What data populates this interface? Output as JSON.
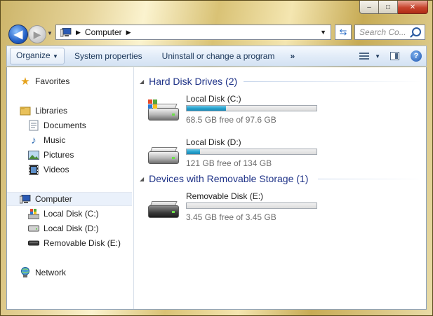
{
  "window": {
    "caption": {
      "minimize": "–",
      "maximize": "□",
      "close": "✕"
    }
  },
  "navbar": {
    "address": {
      "root_icon": "computer-icon",
      "crumb": "Computer"
    },
    "search_placeholder": "Search Co..."
  },
  "toolbar": {
    "organize": "Organize",
    "system_properties": "System properties",
    "uninstall": "Uninstall or change a program",
    "more": "»"
  },
  "sidebar": {
    "favorites": "Favorites",
    "libraries": "Libraries",
    "documents": "Documents",
    "music": "Music",
    "pictures": "Pictures",
    "videos": "Videos",
    "computer": "Computer",
    "local_c": "Local Disk (C:)",
    "local_d": "Local Disk (D:)",
    "removable_e": "Removable Disk (E:)",
    "network": "Network"
  },
  "main": {
    "groups": [
      {
        "title": "Hard Disk Drives (2)",
        "drives": [
          {
            "name": "Local Disk (C:)",
            "free_text": "68.5 GB free of 97.6 GB",
            "used_fraction": 0.3,
            "icon": "windows-drive-icon"
          },
          {
            "name": "Local Disk (D:)",
            "free_text": "121 GB free of 134 GB",
            "used_fraction": 0.1,
            "icon": "hard-drive-icon"
          }
        ]
      },
      {
        "title": "Devices with Removable Storage (1)",
        "drives": [
          {
            "name": "Removable Disk (E:)",
            "free_text": "3.45 GB free of 3.45 GB",
            "used_fraction": 0.0,
            "icon": "removable-drive-icon"
          }
        ]
      }
    ]
  },
  "colors": {
    "group_title": "#1e3287",
    "bar_fill": "#27a4cf",
    "selection": "#eaf1fb"
  }
}
